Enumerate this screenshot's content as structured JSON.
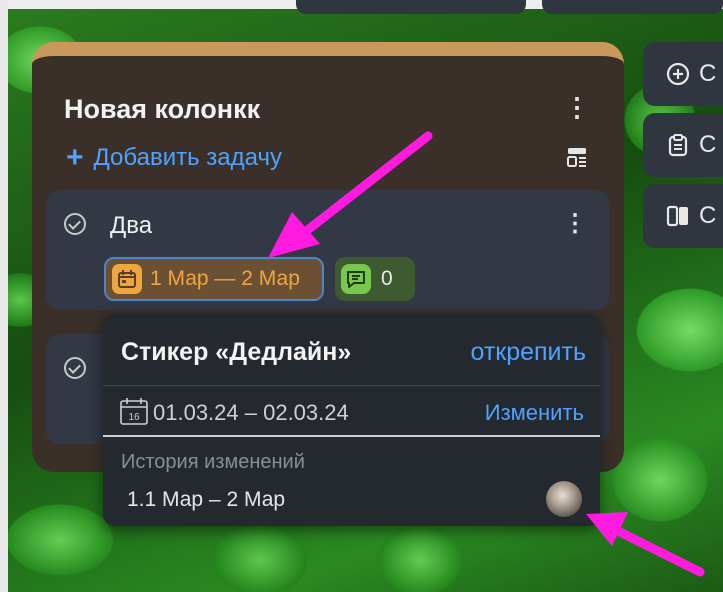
{
  "column": {
    "title": "Новая колонкк",
    "add_task_label": "Добавить задачу",
    "header_color": "#c9995c"
  },
  "card1": {
    "title": "Два",
    "deadline_chip": "1 Мар — 2 Мар",
    "comment_count": "0"
  },
  "popup": {
    "title": "Стикер «Дедлайн»",
    "unpin_label": "открепить",
    "date_range": "01.03.24 – 02.03.24",
    "calendar_day": "16",
    "edit_label": "Изменить",
    "history_heading": "История изменений",
    "history_entry": "1.1 Мар – 2 Мар"
  },
  "side_buttons": [
    {
      "icon": "plus-circle-icon",
      "label": "С"
    },
    {
      "icon": "clipboard-icon",
      "label": "С"
    },
    {
      "icon": "columns-icon",
      "label": "С"
    }
  ],
  "colors": {
    "accent_link": "#4da3ff",
    "deadline_orange": "#f0a640",
    "comment_green": "#7ac74f",
    "annotation_magenta": "#ff1ae0"
  }
}
